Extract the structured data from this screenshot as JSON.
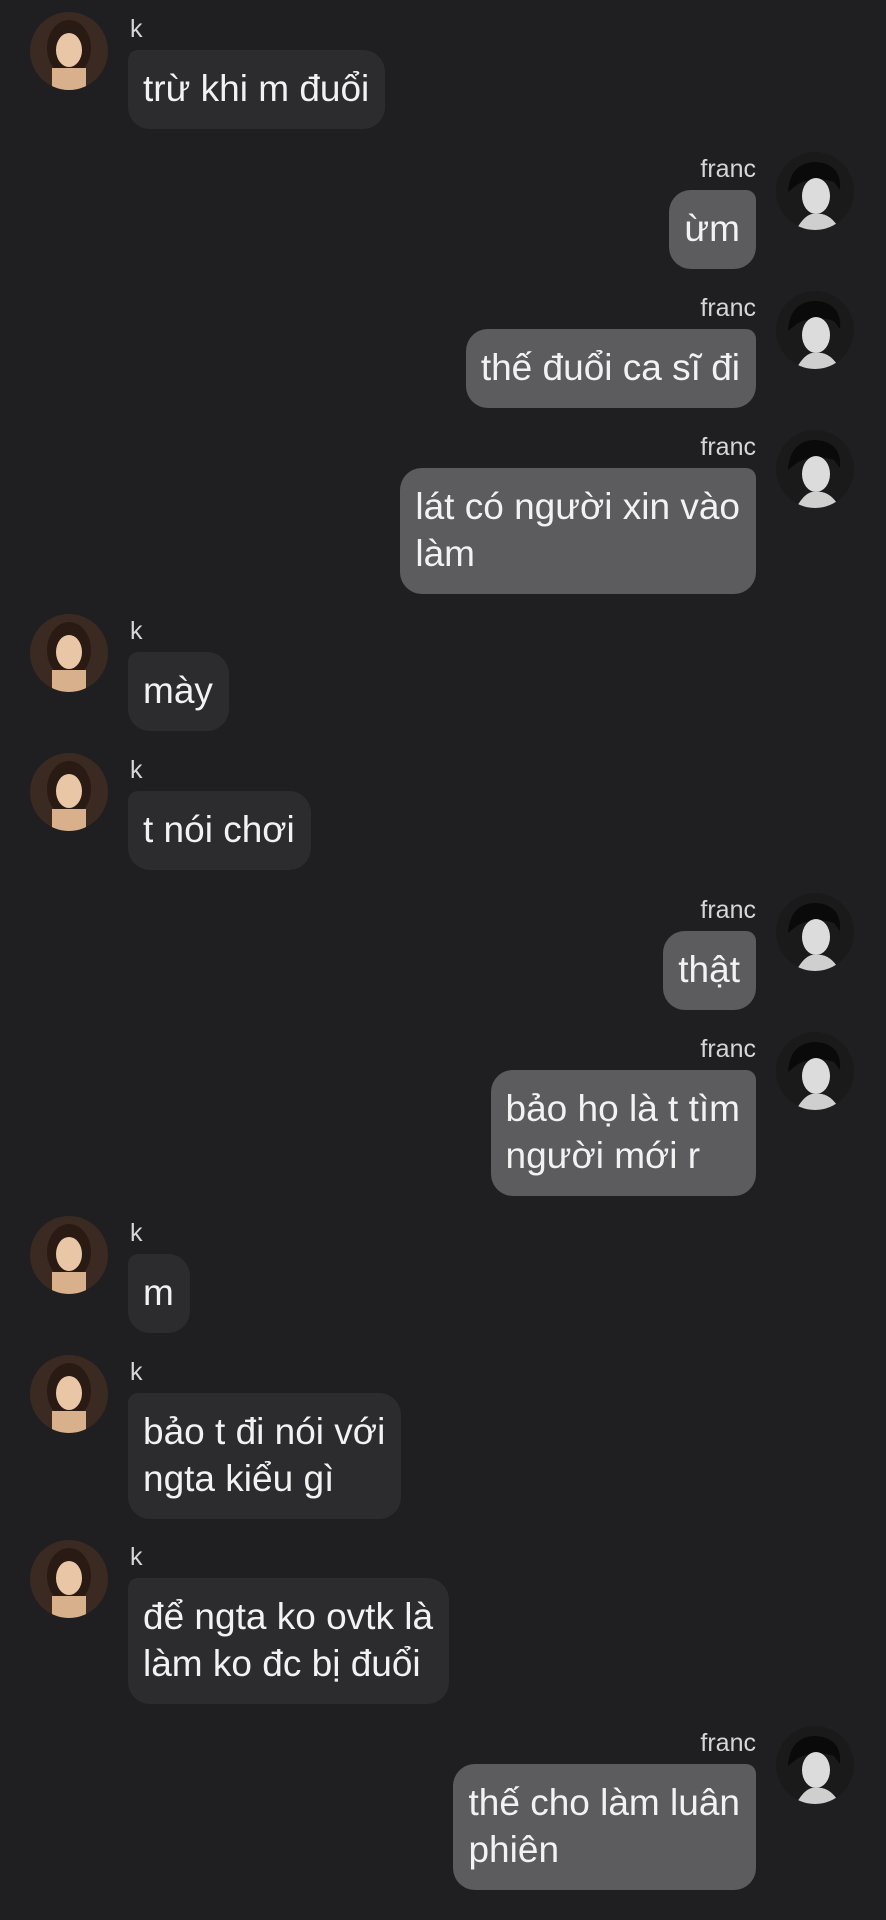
{
  "chat": {
    "messages": [
      {
        "side": "left",
        "sender": "k",
        "text": "trừ khi m đuổi",
        "avatar": "girl-avatar"
      },
      {
        "side": "right",
        "sender": "franc",
        "text": "ừm",
        "avatar": "boy-avatar"
      },
      {
        "side": "right",
        "sender": "franc",
        "text": "thế đuổi ca sĩ đi",
        "avatar": "boy-avatar"
      },
      {
        "side": "right",
        "sender": "franc",
        "text": "lát có người xin vào\nlàm",
        "avatar": "boy-avatar"
      },
      {
        "side": "left",
        "sender": "k",
        "text": "mày",
        "avatar": "girl-avatar"
      },
      {
        "side": "left",
        "sender": "k",
        "text": "t nói chơi",
        "avatar": "girl-avatar"
      },
      {
        "side": "right",
        "sender": "franc",
        "text": "thật",
        "avatar": "boy-avatar"
      },
      {
        "side": "right",
        "sender": "franc",
        "text": "bảo họ là t tìm\nngười mới r",
        "avatar": "boy-avatar"
      },
      {
        "side": "left",
        "sender": "k",
        "text": "m",
        "avatar": "girl-avatar"
      },
      {
        "side": "left",
        "sender": "k",
        "text": "bảo t đi nói với\nngta kiểu gì",
        "avatar": "girl-avatar"
      },
      {
        "side": "left",
        "sender": "k",
        "text": "để ngta ko ovtk là\nlàm ko đc bị đuổi",
        "avatar": "girl-avatar"
      },
      {
        "side": "right",
        "sender": "franc",
        "text": "thế cho làm luân\nphiên",
        "avatar": "boy-avatar"
      }
    ]
  }
}
